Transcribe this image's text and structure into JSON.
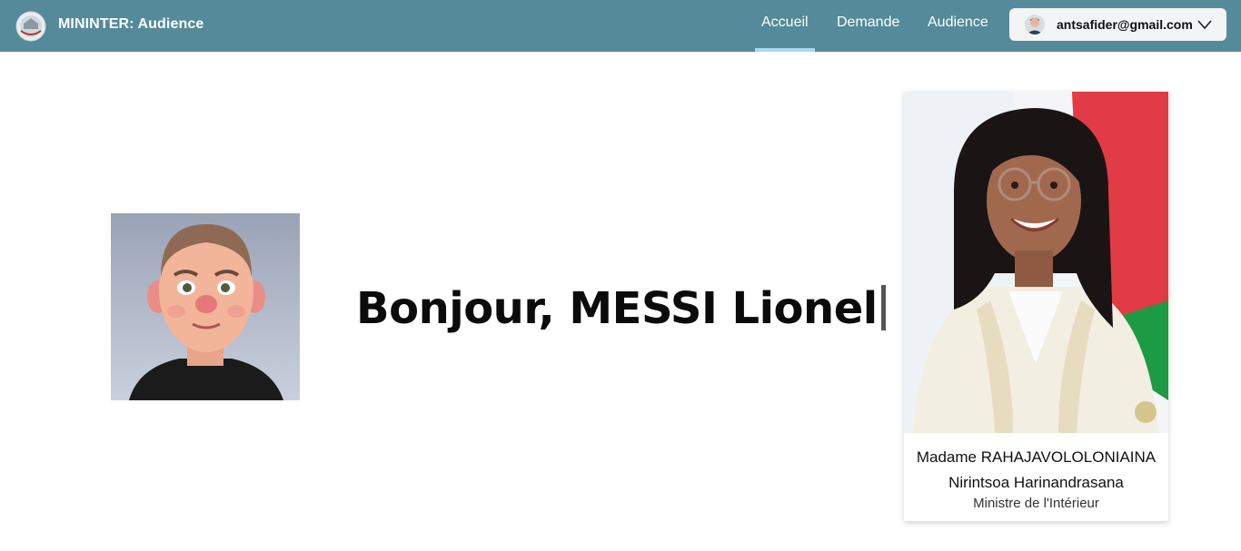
{
  "header": {
    "brand": "MININTER: Audience",
    "nav": [
      {
        "label": "Accueil",
        "active": true
      },
      {
        "label": "Demande",
        "active": false
      },
      {
        "label": "Audience",
        "active": false
      }
    ],
    "user_email": "antsafider@gmail.com"
  },
  "main": {
    "greeting": "Bonjour, MESSI Lionel"
  },
  "minister": {
    "name_line1": "Madame RAHAJAVOLOLONIAINA",
    "name_line2": "Nirintsoa Harinandrasana",
    "role": "Ministre de l'Intérieur"
  },
  "colors": {
    "navbar": "#548a9a",
    "active_underline": "#a9d9f0"
  },
  "icons": [
    "emblem-logo",
    "user-avatar",
    "chevron-down-icon"
  ]
}
